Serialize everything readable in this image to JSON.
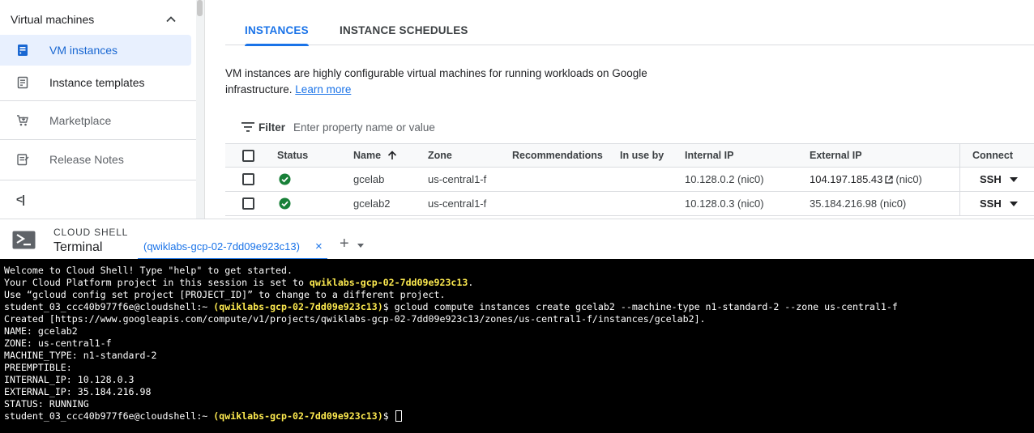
{
  "sidebar": {
    "section_label": "Virtual machines",
    "items": [
      {
        "label": "VM instances"
      },
      {
        "label": "Instance templates"
      },
      {
        "label": "Marketplace"
      },
      {
        "label": "Release Notes"
      }
    ],
    "collapse_label": "<|"
  },
  "tabs": [
    {
      "label": "INSTANCES"
    },
    {
      "label": "INSTANCE SCHEDULES"
    }
  ],
  "description": {
    "text": "VM instances are highly configurable virtual machines for running workloads on Google infrastructure.",
    "link": "Learn more"
  },
  "filter": {
    "label": "Filter",
    "placeholder": "Enter property name or value"
  },
  "table": {
    "columns": [
      "Status",
      "Name",
      "Zone",
      "Recommendations",
      "In use by",
      "Internal IP",
      "External IP",
      "Connect"
    ],
    "rows": [
      {
        "status": "running",
        "name": "gcelab",
        "zone": "us-central1-f",
        "internal_ip": "10.128.0.2 (nic0)",
        "external_ip": "104.197.185.43",
        "external_suffix": "(nic0)",
        "connect": "SSH"
      },
      {
        "status": "running",
        "name": "gcelab2",
        "zone": "us-central1-f",
        "internal_ip": "10.128.0.3 (nic0)",
        "external_ip": "35.184.216.98 (nic0)",
        "external_suffix": "",
        "connect": "SSH"
      }
    ]
  },
  "shell": {
    "title": "CLOUD SHELL",
    "subtitle": "Terminal",
    "tab_label": "(qwiklabs-gcp-02-7dd09e923c13)",
    "close": "×",
    "add": "+"
  },
  "terminal": {
    "project": "qwiklabs-gcp-02-7dd09e923c13",
    "prompt_user": "student_03_ccc40b977f6e@cloudshell:~",
    "line1": "Welcome to Cloud Shell! Type \"help\" to get started.",
    "line2_prefix": "Your Cloud Platform project in this session is set to ",
    "line2_suffix": ".",
    "line3": "Use “gcloud config set project [PROJECT_ID]” to change to a different project.",
    "command": " gcloud compute instances create gcelab2 --machine-type n1-standard-2 --zone us-central1-f",
    "created": "Created [https://www.googleapis.com/compute/v1/projects/qwiklabs-gcp-02-7dd09e923c13/zones/us-central1-f/instances/gcelab2].",
    "out": [
      "NAME: gcelab2",
      "ZONE: us-central1-f",
      "MACHINE_TYPE: n1-standard-2",
      "PREEMPTIBLE:",
      "INTERNAL_IP: 10.128.0.3",
      "EXTERNAL_IP: 35.184.216.98",
      "STATUS: RUNNING"
    ]
  },
  "colors": {
    "accent": "#1a73e8",
    "status_ok": "#188038",
    "terminal_bg": "#000000",
    "terminal_highlight": "#fce94f"
  }
}
